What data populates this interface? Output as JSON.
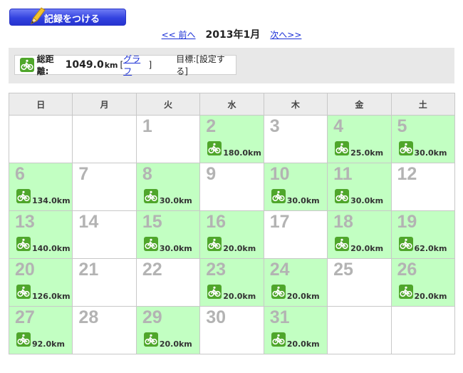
{
  "record_button": {
    "label": "記録をつける"
  },
  "nav": {
    "prev": "<< 前へ",
    "title": "2013年1月",
    "next": "次へ>>"
  },
  "summary": {
    "distance_label": "総距離:",
    "distance_value": "1049.0",
    "distance_unit": "km",
    "graph_open": "[",
    "graph_link": "グラフ",
    "graph_close": "]",
    "goal_text": "目標:[設定する]"
  },
  "weekdays": [
    "日",
    "月",
    "火",
    "水",
    "木",
    "金",
    "土"
  ],
  "weeks": [
    [
      {
        "day": ""
      },
      {
        "day": ""
      },
      {
        "day": "1"
      },
      {
        "day": "2",
        "km": "180.0km"
      },
      {
        "day": "3"
      },
      {
        "day": "4",
        "km": "25.0km"
      },
      {
        "day": "5",
        "km": "30.0km"
      }
    ],
    [
      {
        "day": "6",
        "km": "134.0km"
      },
      {
        "day": "7"
      },
      {
        "day": "8",
        "km": "30.0km"
      },
      {
        "day": "9"
      },
      {
        "day": "10",
        "km": "30.0km"
      },
      {
        "day": "11",
        "km": "30.0km"
      },
      {
        "day": "12"
      }
    ],
    [
      {
        "day": "13",
        "km": "140.0km"
      },
      {
        "day": "14"
      },
      {
        "day": "15",
        "km": "30.0km"
      },
      {
        "day": "16",
        "km": "20.0km"
      },
      {
        "day": "17"
      },
      {
        "day": "18",
        "km": "20.0km"
      },
      {
        "day": "19",
        "km": "62.0km"
      }
    ],
    [
      {
        "day": "20",
        "km": "126.0km"
      },
      {
        "day": "21"
      },
      {
        "day": "22"
      },
      {
        "day": "23",
        "km": "20.0km"
      },
      {
        "day": "24",
        "km": "20.0km"
      },
      {
        "day": "25"
      },
      {
        "day": "26",
        "km": "20.0km"
      }
    ],
    [
      {
        "day": "27",
        "km": "92.0km"
      },
      {
        "day": "28"
      },
      {
        "day": "29",
        "km": "20.0km"
      },
      {
        "day": "30"
      },
      {
        "day": "31",
        "km": "20.0km"
      },
      {
        "day": ""
      },
      {
        "day": ""
      }
    ]
  ],
  "icons": {
    "ride": "bicycle-icon",
    "record": "pencil-icon"
  },
  "colors": {
    "ride_bg": "#c2ffc2",
    "bike_icon": "#4fa62b",
    "button": "#3343e0",
    "link": "#1a2fd6"
  }
}
